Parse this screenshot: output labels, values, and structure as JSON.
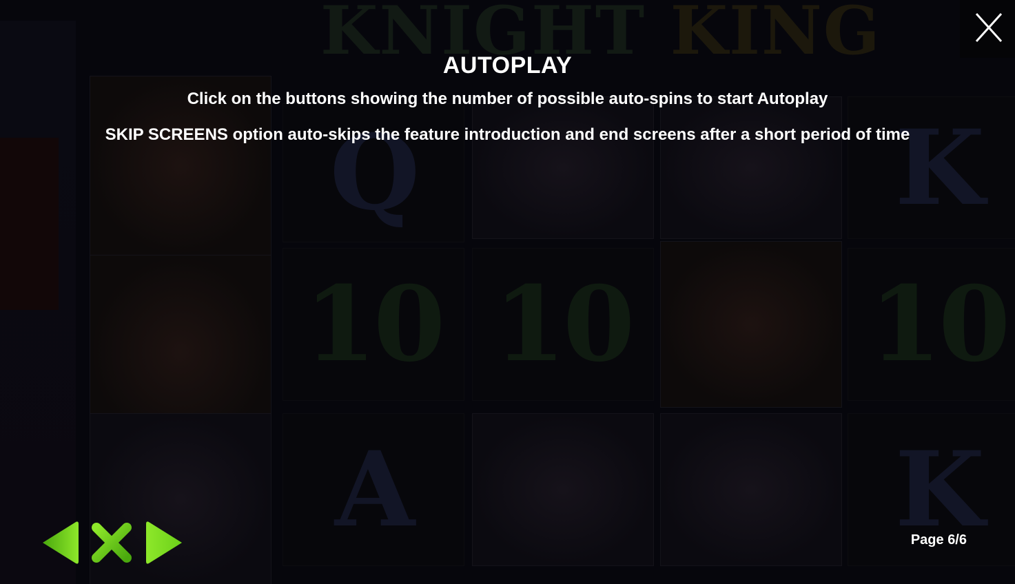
{
  "game": {
    "logo_word_1": "KNIGHT",
    "logo_word_2": "KING",
    "background_symbols": [
      "Q",
      "K",
      "10",
      "10",
      "10",
      "A",
      "K"
    ]
  },
  "rules_page": {
    "title": "AUTOPLAY",
    "line_1": "Click on the buttons showing the number of possible auto-spins to start Autoplay",
    "line_2": "SKIP SCREENS option auto-skips the feature introduction and end screens after a short period of time",
    "page_label": "Page 6/6"
  },
  "controls": {
    "close_icon": "close-x-icon",
    "prev_icon": "arrow-left-icon",
    "exit_icon": "cross-icon",
    "next_icon": "arrow-right-icon"
  },
  "colors": {
    "nav_green_dark": "#4aa80e",
    "nav_green_light": "#8ee82a",
    "text": "#ffffff",
    "overlay": "#06060c"
  }
}
